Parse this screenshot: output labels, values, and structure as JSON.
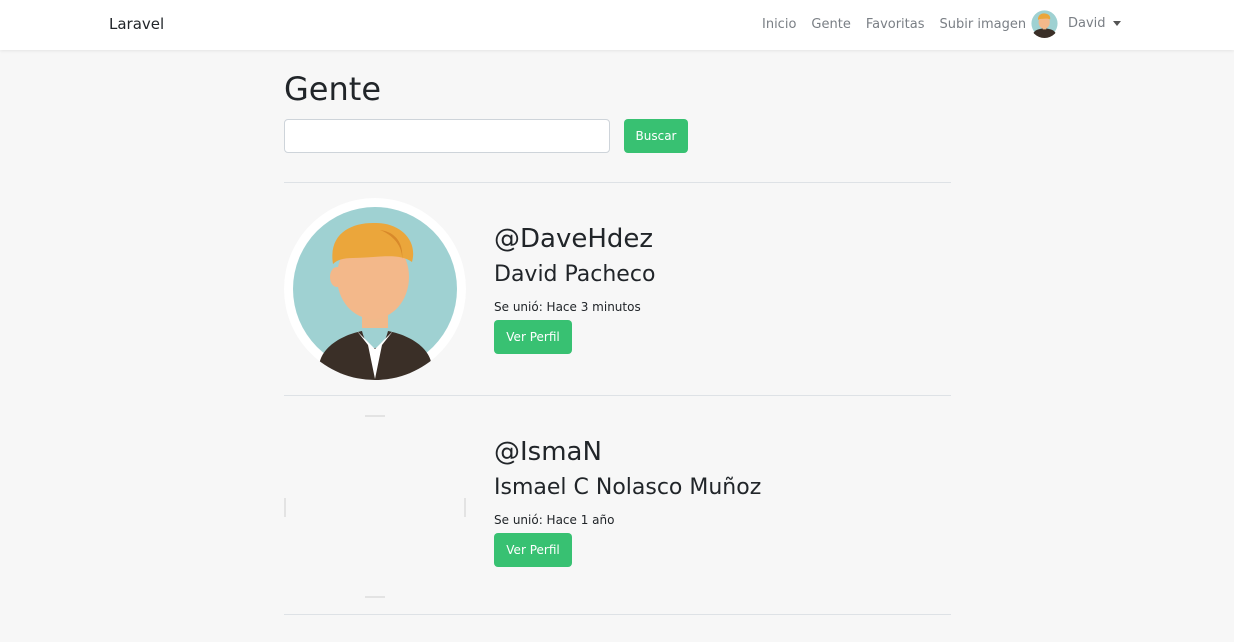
{
  "navbar": {
    "brand": "Laravel",
    "links": [
      "Inicio",
      "Gente",
      "Favoritas",
      "Subir imagen"
    ],
    "user_name": "David"
  },
  "page": {
    "title": "Gente",
    "search_value": "",
    "search_placeholder": "",
    "search_button": "Buscar"
  },
  "users": [
    {
      "username": "@DaveHdez",
      "name": "David Pacheco",
      "joined": "Se unió: Hace 3 minutos",
      "button": "Ver Perfil"
    },
    {
      "username": "@IsmaN",
      "name": "Ismael C Nolasco Muñoz",
      "joined": "Se unió: Hace 1 año",
      "button": "Ver Perfil"
    }
  ],
  "colors": {
    "accent": "#38c172",
    "background": "#f7f7f7",
    "navbar": "#ffffff"
  }
}
